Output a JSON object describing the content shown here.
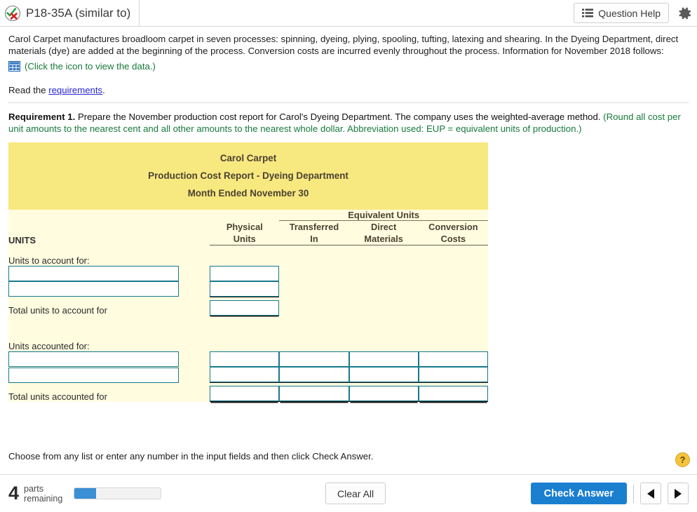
{
  "header": {
    "status_icon": "check-x-circle-icon",
    "question_title": "P18-35A (similar to)",
    "question_help_label": "Question Help",
    "question_help_icon": "list-icon",
    "settings_icon": "gear-icon"
  },
  "intro": {
    "paragraph": "Carol Carpet manufactures broadloom carpet in seven processes: spinning, dyeing, plying, spooling, tufting, latexing and shearing. In the Dyeing Department, direct materials (dye) are added at the beginning of the process. Conversion costs are incurred evenly throughout the process. Information for November 2018 follows:",
    "data_icon": "table-grid-icon",
    "data_link": "(Click the icon to view the data.)",
    "read_prefix": "Read the ",
    "read_link": "requirements",
    "read_suffix": "."
  },
  "requirement": {
    "number_label": "Requirement 1.",
    "text": " Prepare the November production cost report for Carol's Dyeing Department. The company uses the weighted-average method. ",
    "note": "(Round all cost per unit amounts to the nearest cent and all other amounts to the nearest whole dollar. Abbreviation used: EUP = equivalent units of production.)"
  },
  "report": {
    "company": "Carol Carpet",
    "report_title": "Production Cost Report - Dyeing Department",
    "period": "Month Ended November 30",
    "equivalent_units_span": "Equivalent Units",
    "columns": [
      {
        "line1": "Physical",
        "line2": "Units"
      },
      {
        "line1": "Transferred",
        "line2": "In"
      },
      {
        "line1": "Direct",
        "line2": "Materials"
      },
      {
        "line1": "Conversion",
        "line2": "Costs"
      }
    ],
    "units_heading": "UNITS",
    "section_to_account": "Units to account for:",
    "total_to_account": "Total units to account for",
    "section_accounted": "Units accounted for:",
    "total_accounted": "Total units accounted for",
    "inputs": {
      "to_account_row1_label": "",
      "to_account_row1_value": "",
      "to_account_row2_label": "",
      "to_account_row2_value": "",
      "total_to_account_value": "",
      "accounted_row1_label": "",
      "accounted_row1_physical": "",
      "accounted_row1_transferred": "",
      "accounted_row1_materials": "",
      "accounted_row1_conversion": "",
      "accounted_row2_label": "",
      "accounted_row2_physical": "",
      "accounted_row2_transferred": "",
      "accounted_row2_materials": "",
      "accounted_row2_conversion": "",
      "total_physical": "",
      "total_transferred": "",
      "total_materials": "",
      "total_conversion": ""
    }
  },
  "footer": {
    "instruction": "Choose from any list or enter any number in the input fields and then click Check Answer.",
    "help_badge": "?",
    "parts_count": "4",
    "parts_label_line1": "parts",
    "parts_label_line2": "remaining",
    "progress_percent": 25,
    "clear_all_label": "Clear All",
    "check_answer_label": "Check Answer",
    "prev_icon": "triangle-left-icon",
    "next_icon": "triangle-right-icon"
  },
  "colors": {
    "header_yellow": "#f8e880",
    "body_cream": "#fffce0",
    "input_border": "#17798c",
    "accent_blue": "#1b7fd0",
    "link_blue": "#2727d6",
    "note_green": "#17793b"
  }
}
